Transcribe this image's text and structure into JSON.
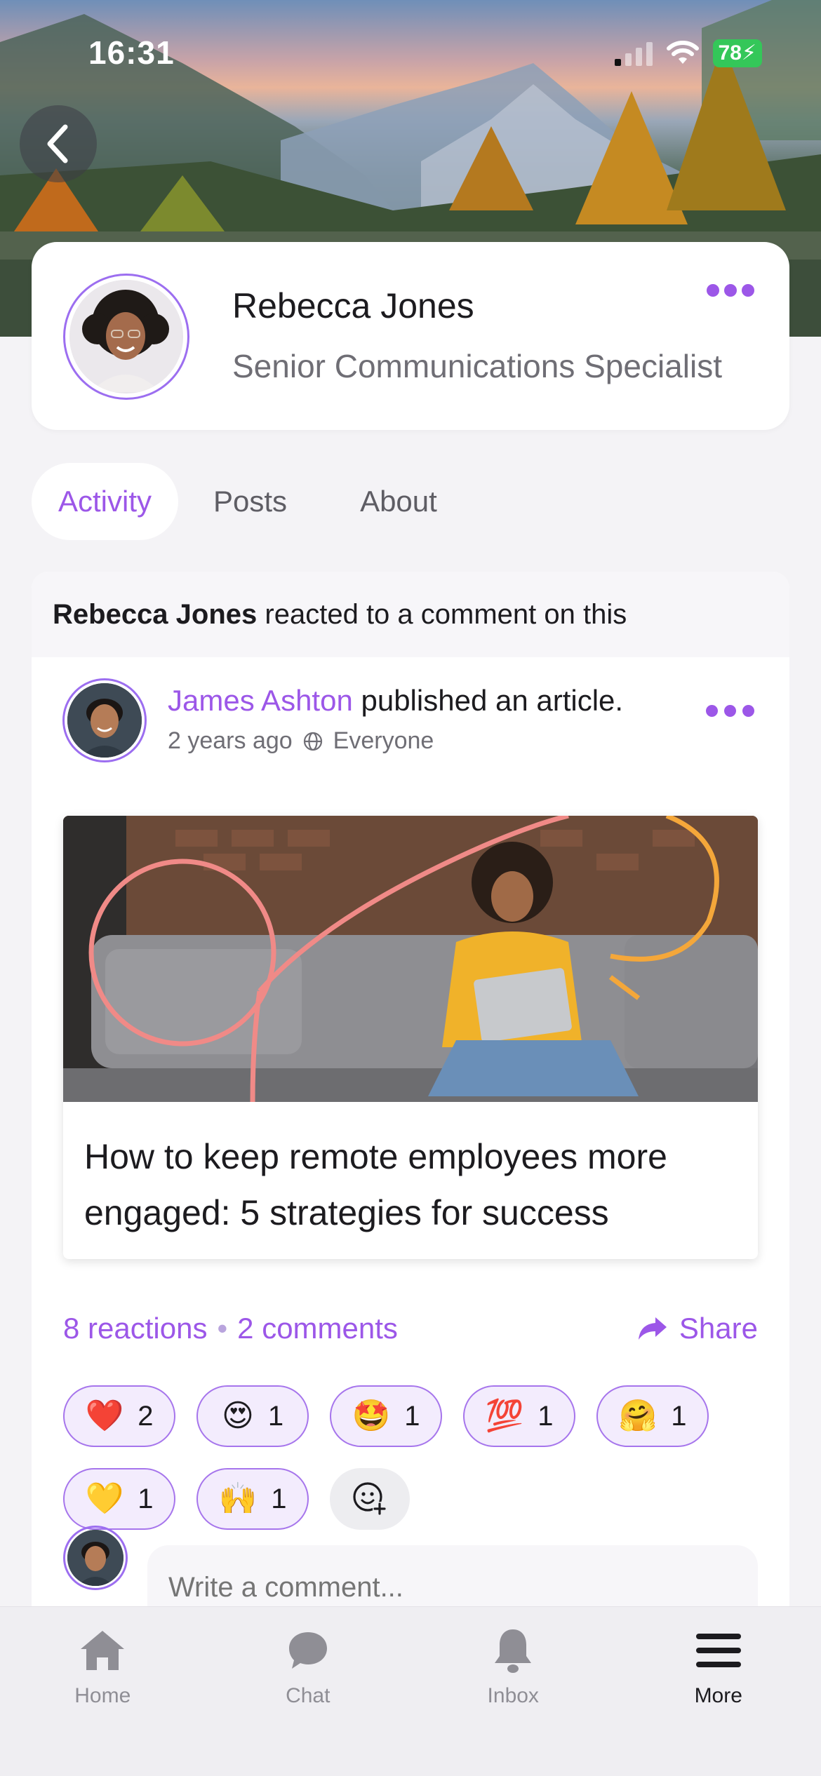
{
  "status_bar": {
    "time": "16:31",
    "battery": "78"
  },
  "profile": {
    "name": "Rebecca Jones",
    "title": "Senior Communications Specialist"
  },
  "tabs": [
    {
      "label": "Activity",
      "active": true
    },
    {
      "label": "Posts",
      "active": false
    },
    {
      "label": "About",
      "active": false
    }
  ],
  "activity": {
    "actor": "Rebecca Jones",
    "action": "reacted to a comment on this"
  },
  "post": {
    "author": "James Ashton",
    "action": "published an article.",
    "time": "2 years ago",
    "audience": "Everyone",
    "article_title": "How to keep remote employees more engaged: 5 strategies for success",
    "reactions_count": "8 reactions",
    "separator": "•",
    "comments_count": "2 comments",
    "share_label": "Share"
  },
  "reactions": [
    {
      "emoji": "❤️",
      "count": "2"
    },
    {
      "emoji": "😍",
      "count": "1"
    },
    {
      "emoji": "🤩",
      "count": "1"
    },
    {
      "emoji": "💯",
      "count": "1"
    },
    {
      "emoji": "🤗",
      "count": "1"
    },
    {
      "emoji": "💛",
      "count": "1"
    },
    {
      "emoji": "🙌",
      "count": "1"
    }
  ],
  "comment": {
    "placeholder": "Write a comment..."
  },
  "bottom_nav": [
    {
      "label": "Home",
      "icon": "home-icon"
    },
    {
      "label": "Chat",
      "icon": "chat-icon"
    },
    {
      "label": "Inbox",
      "icon": "bell-icon"
    },
    {
      "label": "More",
      "icon": "menu-icon",
      "active": true
    }
  ],
  "colors": {
    "accent": "#9c57e8",
    "chip_bg": "#f3ecfd",
    "chip_border": "#a675ec"
  }
}
